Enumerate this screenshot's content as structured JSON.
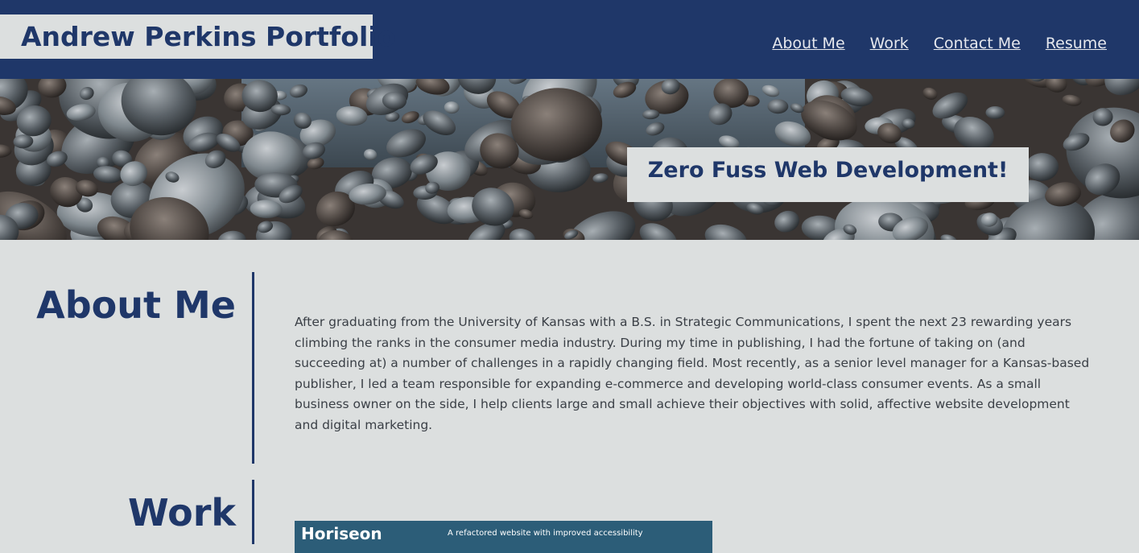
{
  "header": {
    "brand": "Andrew Perkins Portfolio",
    "nav": [
      "About Me",
      "Work",
      "Contact Me",
      "Resume"
    ]
  },
  "hero": {
    "tagline": "Zero Fuss Web Development!"
  },
  "about": {
    "heading": "About Me",
    "body": "After graduating from the University of Kansas with a B.S. in Strategic Communications, I spent the next 23 rewarding years climbing the ranks in the consumer media industry. During my time in publishing, I had the fortune of taking on (and succeeding at) a number of challenges in a rapidly changing field. Most recently, as a senior level manager for a Kansas-based publisher, I led a team responsible for expanding e-commerce and developing world-class consumer events. As a small business owner on the side, I help clients large and small achieve their objectives with solid, affective website development and digital marketing."
  },
  "work": {
    "heading": "Work",
    "projects": [
      {
        "title": "Horiseon",
        "description": "A refactored website with improved accessibility"
      }
    ]
  },
  "colors": {
    "primary": "#1f3769",
    "background": "#dcdfdf",
    "card": "#2c5d78"
  }
}
